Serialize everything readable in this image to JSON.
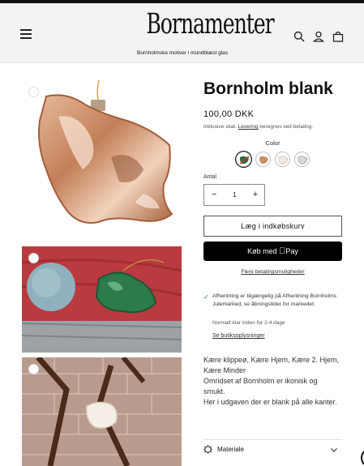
{
  "header": {
    "logo_text": "Bornamenter",
    "tagline": "Bornholmske motiver i mundblæst glas",
    "icons": [
      "menu-icon",
      "search-icon",
      "account-icon",
      "cart-icon"
    ]
  },
  "product": {
    "title": "Bornholm blank",
    "price": "100,00 DKK",
    "tax_prefix": "Inklusive skat.",
    "tax_link": "Levering",
    "tax_suffix": "beregnes ved betaling.",
    "color_label": "Color",
    "swatches": [
      {
        "name": "green",
        "color": "#2f6a3c"
      },
      {
        "name": "copper",
        "color": "#c98f64"
      },
      {
        "name": "blank",
        "color": "#f0ede6"
      },
      {
        "name": "silver",
        "color": "#d8d8d8"
      }
    ],
    "qty_label": "Antal",
    "qty_value": "1",
    "qty_minus": "−",
    "qty_plus": "+",
    "add_to_cart": "Læg i indkøbskurv",
    "pay_prefix": "Køb med",
    "pay_brand": "Pay",
    "more_payment": "Flere betalingsmuligheder",
    "pickup_text_1": "Afhentning er tilgængelig på",
    "pickup_bold": "Afhentning Bornholms Julemarked, se åbningstider for markedet.",
    "pickup_ready": "Normalt klar inden for 2-4 dage",
    "store_link": "Se butiksoplysninger",
    "description": [
      "Kære klippeø, Kære Hjem, Kære 2. Hjem, Kære Minder",
      "Omridset af Bornholm er ikonisk og smukt.",
      "Her i udgaven der er blank på alle kanter."
    ],
    "accordion_label": "Materiale"
  },
  "colors": {
    "paypal_black": "#000000",
    "check_green": "#1e7b45",
    "ornament_copper": "#c98f64",
    "ornament_green": "#2f6a3c"
  }
}
